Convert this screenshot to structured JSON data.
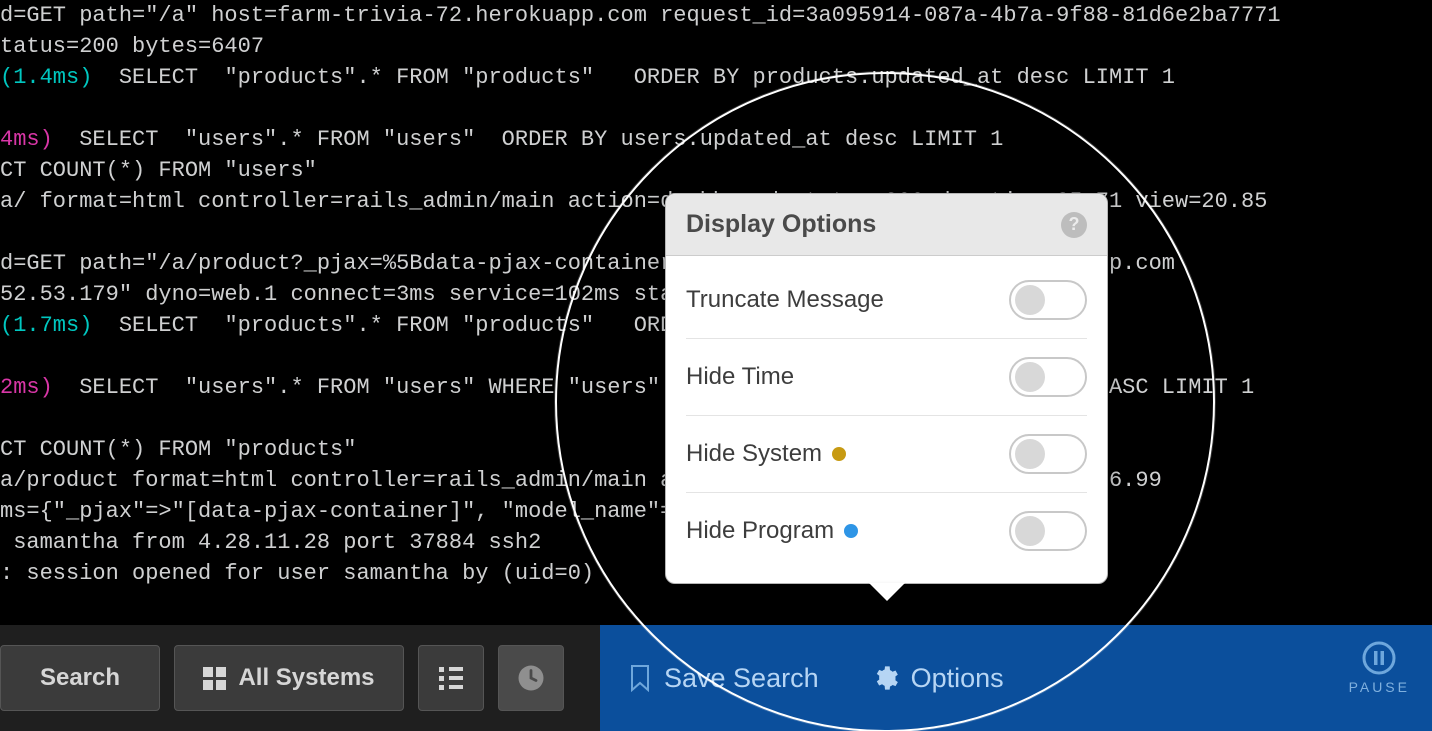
{
  "log_lines": [
    {
      "segments": [
        {
          "text": "d=GET path=\"/a\" host=farm-trivia-72.herokuapp.com request_id=3a095914-087a-4b7a-9f88-81d6e2ba7771",
          "cls": "c-gray"
        }
      ]
    },
    {
      "segments": [
        {
          "text": "tatus=200 bytes=6407",
          "cls": "c-gray"
        }
      ]
    },
    {
      "segments": [
        {
          "text": "(1.4ms)",
          "cls": "c-cyan"
        },
        {
          "text": "  SELECT  \"products\".* FROM \"products\"   ORDER BY products.updated_at desc LIMIT 1",
          "cls": "c-gray"
        }
      ]
    },
    {
      "segments": [
        {
          "text": " ",
          "cls": "c-gray"
        }
      ]
    },
    {
      "segments": [
        {
          "text": "4ms)",
          "cls": "c-magenta"
        },
        {
          "text": "  SELECT  \"users\".* FROM \"users\"  ORDER BY users.updated_at desc LIMIT 1",
          "cls": "c-gray"
        }
      ]
    },
    {
      "segments": [
        {
          "text": "CT COUNT(*) FROM \"users\"",
          "cls": "c-gray"
        }
      ]
    },
    {
      "segments": [
        {
          "text": "a/ format=html controller=rails_admin/main action=dashboard status=200 duration=35.71 view=20.85",
          "cls": "c-gray"
        }
      ]
    },
    {
      "segments": [
        {
          "text": " ",
          "cls": "c-gray"
        }
      ]
    },
    {
      "segments": [
        {
          "text": "d=GET path=\"/a/product?_pjax=%5Bdata-pjax-container%5D\" host=farm-trivia-72.herokuapp.com",
          "cls": "c-gray"
        }
      ]
    },
    {
      "segments": [
        {
          "text": "52.53.179\" dyno=web.1 connect=3ms service=102ms status=200 bytes=5534",
          "cls": "c-gray"
        }
      ]
    },
    {
      "segments": [
        {
          "text": "(1.7ms)",
          "cls": "c-cyan"
        },
        {
          "text": "  SELECT  \"products\".* FROM \"products\"   ORDER BY products.id desc LIMIT 20",
          "cls": "c-gray"
        }
      ]
    },
    {
      "segments": [
        {
          "text": " ",
          "cls": "c-gray"
        }
      ]
    },
    {
      "segments": [
        {
          "text": "2ms)",
          "cls": "c-magenta"
        },
        {
          "text": "  SELECT  \"users\".* FROM \"users\" WHERE \"users\".\"id\" = $1  ORDER BY \"users\".\"id\" ASC LIMIT 1",
          "cls": "c-gray"
        }
      ]
    },
    {
      "segments": [
        {
          "text": " ",
          "cls": "c-gray"
        }
      ]
    },
    {
      "segments": [
        {
          "text": "CT COUNT(*) FROM \"products\"",
          "cls": "c-gray"
        }
      ]
    },
    {
      "segments": [
        {
          "text": "a/product format=html controller=rails_admin/main action=index status=200 duration=76.99",
          "cls": "c-gray"
        }
      ]
    },
    {
      "segments": [
        {
          "text": "ms={\"_pjax\"=>\"[data-pjax-container]\", \"model_name\"=>\"product\"}",
          "cls": "c-gray"
        }
      ]
    },
    {
      "segments": [
        {
          "text": " samantha from 4.28.11.28 port 37884 ssh2",
          "cls": "c-gray"
        }
      ]
    },
    {
      "segments": [
        {
          "text": ": session opened for user samantha by (uid=0)",
          "cls": "c-gray"
        }
      ]
    }
  ],
  "toolbar": {
    "search_label": "Search",
    "all_systems_label": "All Systems",
    "save_search_label": "Save Search",
    "options_label": "Options",
    "pause_label": "PAUSE"
  },
  "popover": {
    "title": "Display Options",
    "options": [
      {
        "label": "Truncate Message",
        "dot": null,
        "on": false
      },
      {
        "label": "Hide Time",
        "dot": null,
        "on": false
      },
      {
        "label": "Hide System",
        "dot": "#c79a12",
        "on": false
      },
      {
        "label": "Hide Program",
        "dot": "#2e95e6",
        "on": false
      }
    ]
  }
}
